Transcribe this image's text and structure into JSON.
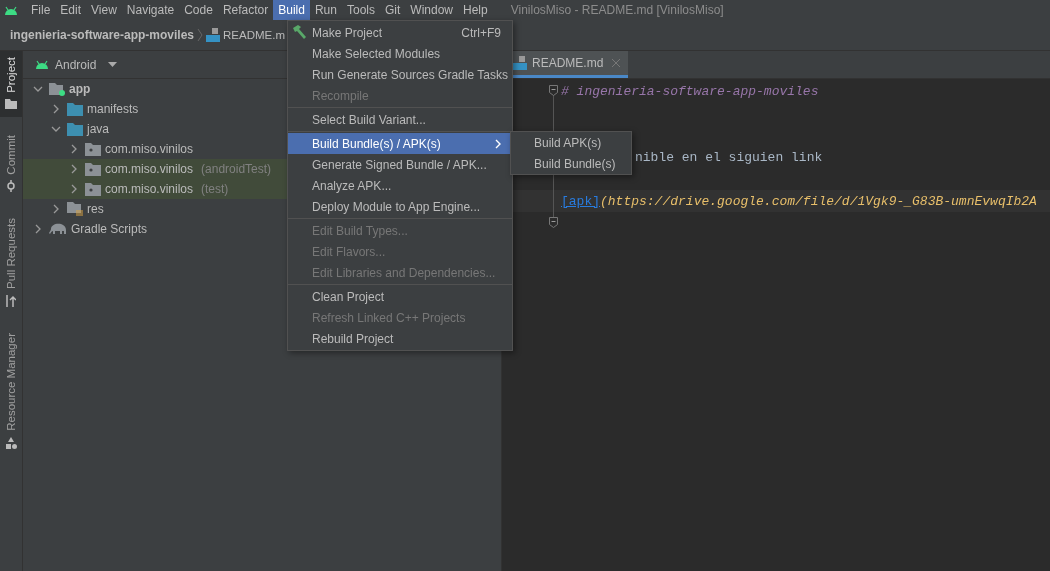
{
  "menu_bar": {
    "items": [
      {
        "label": "File",
        "selected": false
      },
      {
        "label": "Edit",
        "selected": false
      },
      {
        "label": "View",
        "selected": false
      },
      {
        "label": "Navigate",
        "selected": false
      },
      {
        "label": "Code",
        "selected": false
      },
      {
        "label": "Refactor",
        "selected": false
      },
      {
        "label": "Build",
        "selected": true
      },
      {
        "label": "Run",
        "selected": false
      },
      {
        "label": "Tools",
        "selected": false
      },
      {
        "label": "Git",
        "selected": false
      },
      {
        "label": "Window",
        "selected": false
      },
      {
        "label": "Help",
        "selected": false
      }
    ],
    "window_title": "VinilosMiso - README.md [VinilosMiso]"
  },
  "breadcrumb": {
    "project": "ingenieria-software-app-moviles",
    "file": "README.m"
  },
  "tool_strip": [
    {
      "label": "Project",
      "selected": true,
      "kind": "project"
    },
    {
      "label": "Commit",
      "selected": false,
      "kind": "commit"
    },
    {
      "label": "Pull Requests",
      "selected": false,
      "kind": "pull"
    },
    {
      "label": "Resource Manager",
      "selected": false,
      "kind": "resource"
    }
  ],
  "project_panel": {
    "view": "Android",
    "tree": [
      {
        "label": "app",
        "kind": "module",
        "expanded": true,
        "tinted": false,
        "children": [
          {
            "label": "manifests",
            "kind": "folder",
            "expanded": false,
            "tinted": false
          },
          {
            "label": "java",
            "kind": "folder",
            "expanded": true,
            "tinted": false,
            "children": [
              {
                "label": "com.miso.vinilos",
                "kind": "package",
                "expanded": false,
                "tinted": false
              },
              {
                "label": "com.miso.vinilos",
                "suffix": "(androidTest)",
                "kind": "package",
                "expanded": false,
                "tinted": true
              },
              {
                "label": "com.miso.vinilos",
                "suffix": "(test)",
                "kind": "package",
                "expanded": false,
                "tinted": true
              }
            ]
          },
          {
            "label": "res",
            "kind": "resources",
            "expanded": false,
            "tinted": false
          }
        ]
      },
      {
        "label": "Gradle Scripts",
        "kind": "gradle",
        "expanded": false,
        "tinted": false
      }
    ]
  },
  "editor": {
    "tab": {
      "label": "README.md",
      "selected": true
    },
    "lines": [
      {
        "kind": "heading",
        "text": "# ingenieria-software-app-moviles"
      },
      {
        "kind": "blank"
      },
      {
        "kind": "blank"
      },
      {
        "kind": "covered",
        "text": "nible en el siguien link"
      },
      {
        "kind": "blank"
      },
      {
        "kind": "link",
        "link_text": "[apk]",
        "url": "(https://drive.google.com/file/d/1Vgk9-_G83B-umnEvwqIb2A"
      },
      {
        "kind": "fold_end"
      }
    ]
  },
  "build_menu": {
    "groups": [
      [
        {
          "label": "Make Project",
          "shortcut": "Ctrl+F9",
          "disabled": false,
          "selected": false
        },
        {
          "label": "Make Selected Modules",
          "disabled": false,
          "selected": false
        },
        {
          "label": "Run Generate Sources Gradle Tasks",
          "disabled": false,
          "selected": false
        },
        {
          "label": "Recompile",
          "disabled": true,
          "selected": false
        }
      ],
      [
        {
          "label": "Select Build Variant...",
          "disabled": false,
          "selected": false
        }
      ],
      [
        {
          "label": "Build Bundle(s) / APK(s)",
          "submenu": true,
          "disabled": false,
          "selected": true
        },
        {
          "label": "Generate Signed Bundle / APK...",
          "disabled": false,
          "selected": false
        },
        {
          "label": "Analyze APK...",
          "disabled": false,
          "selected": false
        },
        {
          "label": "Deploy Module to App Engine...",
          "disabled": false,
          "selected": false
        }
      ],
      [
        {
          "label": "Edit Build Types...",
          "disabled": true,
          "selected": false
        },
        {
          "label": "Edit Flavors...",
          "disabled": true,
          "selected": false
        },
        {
          "label": "Edit Libraries and Dependencies...",
          "disabled": true,
          "selected": false
        }
      ],
      [
        {
          "label": "Clean Project",
          "disabled": false,
          "selected": false
        },
        {
          "label": "Refresh Linked C++ Projects",
          "disabled": true,
          "selected": false
        },
        {
          "label": "Rebuild Project",
          "disabled": false,
          "selected": false
        }
      ]
    ],
    "submenu": [
      "Build APK(s)",
      "Build Bundle(s)"
    ]
  }
}
